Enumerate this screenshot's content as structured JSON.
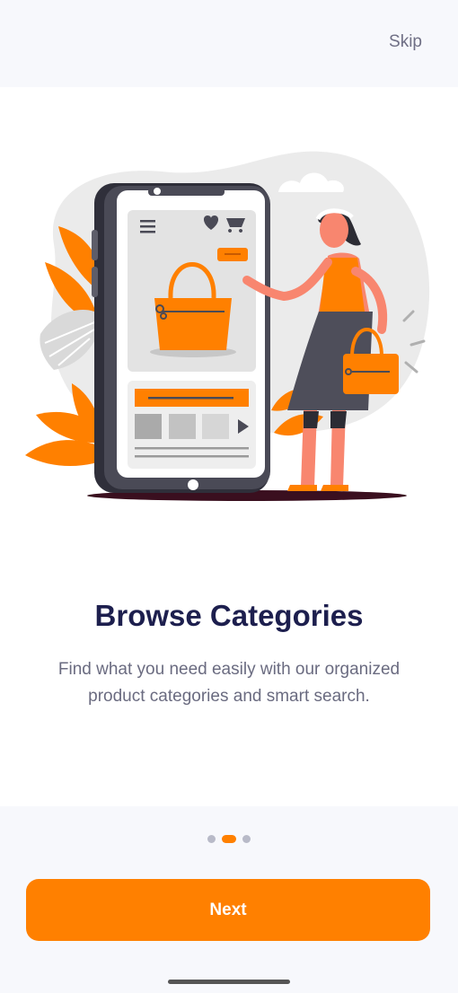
{
  "header": {
    "skip_label": "Skip"
  },
  "onboarding": {
    "title": "Browse Categories",
    "description": "Find what you need easily with our organized product categories and smart search.",
    "page_index": 1,
    "page_count": 3
  },
  "footer": {
    "next_label": "Next"
  },
  "colors": {
    "accent": "#ff8000",
    "title": "#1d1f4e",
    "body_text": "#6a6b80",
    "inactive_dot": "#b8bac8"
  },
  "icons": {
    "illustration": "shopping-phone-illustration",
    "menu": "menu-icon",
    "heart": "heart-icon",
    "cart": "cart-icon",
    "play": "play-icon"
  }
}
